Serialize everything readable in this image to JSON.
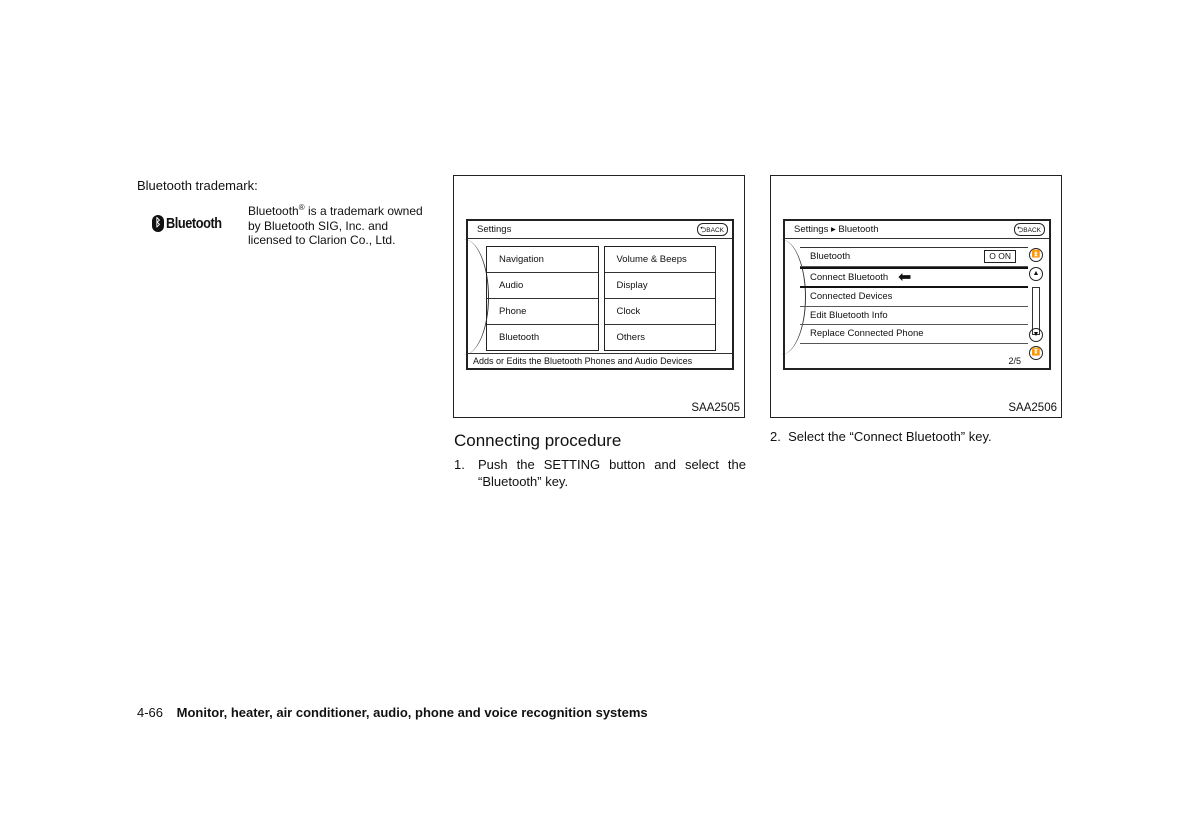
{
  "trademark": {
    "heading": "Bluetooth trademark:",
    "logo_text": "Bluetooth",
    "logo_icon": "bluetooth-rune-icon",
    "text_prefix": "Bluetooth",
    "registered": "®",
    "text_rest": " is a trademark owned by Bluetooth SIG, Inc. and licensed to Clarion Co., Ltd."
  },
  "figure1": {
    "code": "SAA2505",
    "screen_title": "Settings",
    "back_label": "BACK",
    "left_items": [
      "Navigation",
      "Audio",
      "Phone",
      "Bluetooth"
    ],
    "right_items": [
      "Volume & Beeps",
      "Display",
      "Clock",
      "Others"
    ],
    "status": "Adds or Edits the Bluetooth Phones and Audio Devices"
  },
  "figure2": {
    "code": "SAA2506",
    "screen_title": "Settings ▸ Bluetooth",
    "back_label": "BACK",
    "items": [
      "Bluetooth",
      "Connect Bluetooth",
      "Connected Devices",
      "Edit Bluetooth Info",
      "Replace Connected Phone"
    ],
    "toggle_label": "O ON",
    "selected_item": "Connect Bluetooth",
    "page_indicator": "2/5"
  },
  "procedure": {
    "heading": "Connecting procedure",
    "step1_num": "1.",
    "step1_text": "Push the SETTING button and select the “Bluetooth” key.",
    "step2_num": "2.",
    "step2_text": "Select the “Connect Bluetooth” key."
  },
  "footer": {
    "page": "4-66",
    "section": "Monitor, heater, air conditioner, audio, phone and voice recognition systems"
  }
}
